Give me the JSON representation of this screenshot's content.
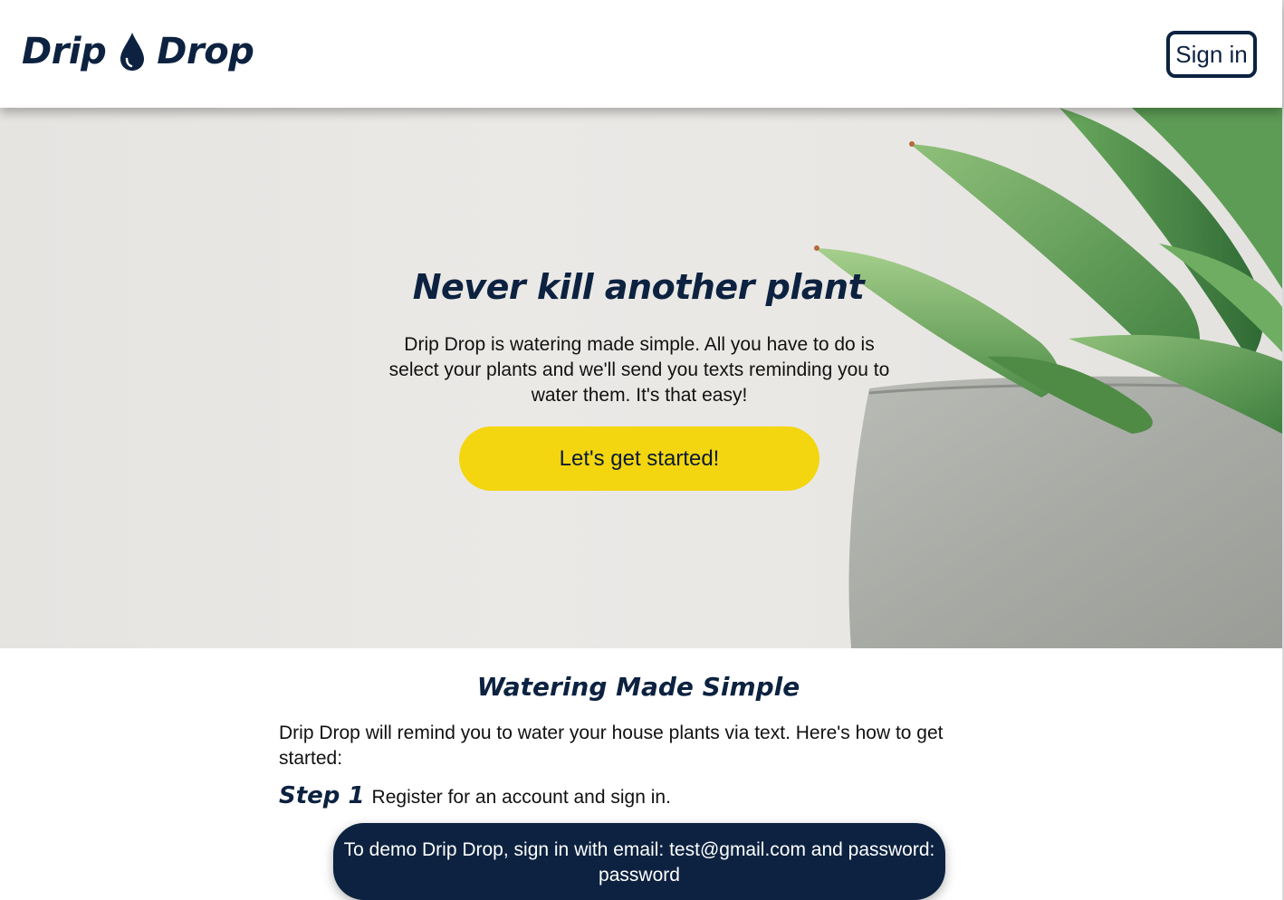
{
  "header": {
    "logo_left": "Drip",
    "logo_right": "Drop",
    "signin_label": "Sign in"
  },
  "hero": {
    "title": "Never kill another plant",
    "description": "Drip Drop is watering made simple. All you have to do is select your plants and we'll send you texts reminding you to water them. It's that easy!",
    "cta_label": "Let's get started!"
  },
  "section": {
    "title": "Watering Made Simple",
    "intro": "Drip Drop will remind you to water your house plants via text. Here's how to get started:",
    "steps": [
      {
        "label": "Step 1",
        "text": "Register for an account and sign in."
      }
    ]
  },
  "banner": {
    "text": "To demo Drip Drop, sign in with email: test@gmail.com and password: password"
  },
  "colors": {
    "brand_navy": "#0c2240",
    "cta_yellow": "#f3d60f"
  },
  "icons": {
    "logo_icon": "water-drop-icon"
  }
}
